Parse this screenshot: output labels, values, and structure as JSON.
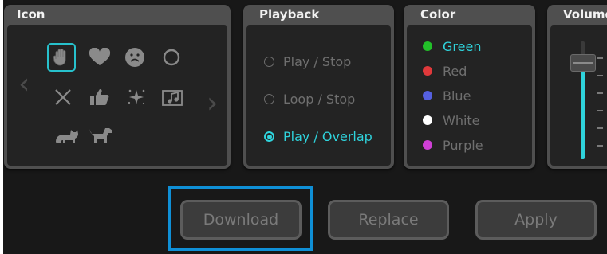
{
  "panels": {
    "icon": {
      "title": "Icon",
      "icons": [
        {
          "name": "hand-icon",
          "selected": true
        },
        {
          "name": "heart-icon",
          "selected": false
        },
        {
          "name": "sad-face-icon",
          "selected": false
        },
        {
          "name": "circle-icon",
          "selected": false
        },
        {
          "name": "x-icon",
          "selected": false
        },
        {
          "name": "thumbs-up-icon",
          "selected": false
        },
        {
          "name": "sparkle-icon",
          "selected": false
        },
        {
          "name": "music-icon",
          "selected": false
        },
        {
          "name": "cat-icon",
          "selected": false
        },
        {
          "name": "dog-icon",
          "selected": false
        }
      ],
      "prev_glyph": "‹",
      "next_glyph": "›"
    },
    "playback": {
      "title": "Playback",
      "options": [
        {
          "label": "Play / Stop",
          "selected": false
        },
        {
          "label": "Loop / Stop",
          "selected": false
        },
        {
          "label": "Play / Overlap",
          "selected": true
        }
      ]
    },
    "color": {
      "title": "Color",
      "options": [
        {
          "label": "Green",
          "color": "#22c029",
          "selected": true
        },
        {
          "label": "Red",
          "color": "#e0393b",
          "selected": false
        },
        {
          "label": "Blue",
          "color": "#5560e0",
          "selected": false
        },
        {
          "label": "White",
          "color": "#ffffff",
          "selected": false
        },
        {
          "label": "Purple",
          "color": "#cf3fd6",
          "selected": false
        }
      ]
    },
    "volume": {
      "title": "Volume",
      "level": 0.82,
      "accent": "#2fd3dc"
    }
  },
  "buttons": {
    "download": "Download",
    "replace": "Replace",
    "apply": "Apply"
  },
  "colors": {
    "accent": "#2fd3dc",
    "highlight": "#0f8fd6"
  }
}
